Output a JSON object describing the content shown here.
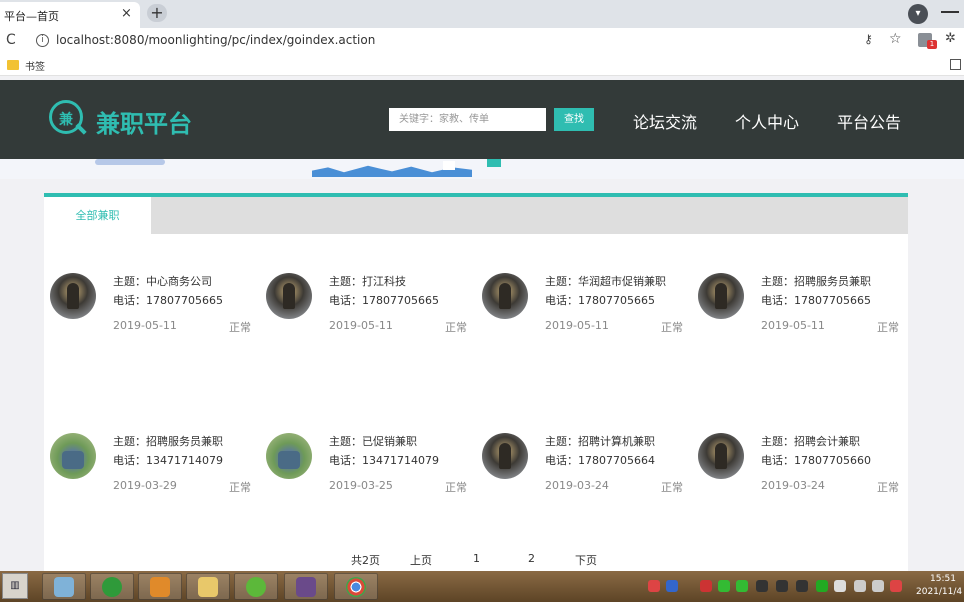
{
  "browser": {
    "tab_title": "平台—首页",
    "tab_close": "×",
    "new_tab": "+",
    "url": "localhost:8080/moonlighting/pc/index/goindex.action",
    "bookmark_folder": "书签",
    "reload_icon": "C"
  },
  "site": {
    "logo_mark": "兼",
    "logo_text": "兼职平台",
    "search_placeholder": "关键字：家教、传单",
    "search_button": "查找",
    "nav": [
      "论坛交流",
      "个人中心",
      "平台公告"
    ],
    "accent_color": "#2fbdb1",
    "header_color": "#333a39"
  },
  "tabs": {
    "active": "全部兼职"
  },
  "jobs": [
    {
      "title": "主题：中心商务公司",
      "phone": "电话：17807705665",
      "date": "2019-05-11",
      "status": "正常",
      "avatar": "warrior-avatar"
    },
    {
      "title": "主题：打江科技",
      "phone": "电话：17807705665",
      "date": "2019-05-11",
      "status": "正常",
      "avatar": "warrior-avatar"
    },
    {
      "title": "主题：华润超市促销兼职",
      "phone": "电话：17807705665",
      "date": "2019-05-11",
      "status": "正常",
      "avatar": "warrior-avatar"
    },
    {
      "title": "主题：招聘服务员兼职",
      "phone": "电话：17807705665",
      "date": "2019-05-11",
      "status": "正常",
      "avatar": "warrior-avatar"
    },
    {
      "title": "主题：招聘服务员兼职",
      "phone": "电话：13471714079",
      "date": "2019-03-29",
      "status": "正常",
      "avatar": "scenic-avatar"
    },
    {
      "title": "主题：已促销兼职",
      "phone": "电话：13471714079",
      "date": "2019-03-25",
      "status": "正常",
      "avatar": "scenic-avatar"
    },
    {
      "title": "主题：招聘计算机兼职",
      "phone": "电话：17807705664",
      "date": "2019-03-24",
      "status": "正常",
      "avatar": "warrior-avatar"
    },
    {
      "title": "主题：招聘会计兼职",
      "phone": "电话：17807705660",
      "date": "2019-03-24",
      "status": "正常",
      "avatar": "warrior-avatar"
    }
  ],
  "pager": {
    "total": "共2页",
    "prev": "上页",
    "page1": "1",
    "page2": "2",
    "next": "下页"
  },
  "taskbar": {
    "time": "15:51",
    "date": "2021/11/4"
  }
}
